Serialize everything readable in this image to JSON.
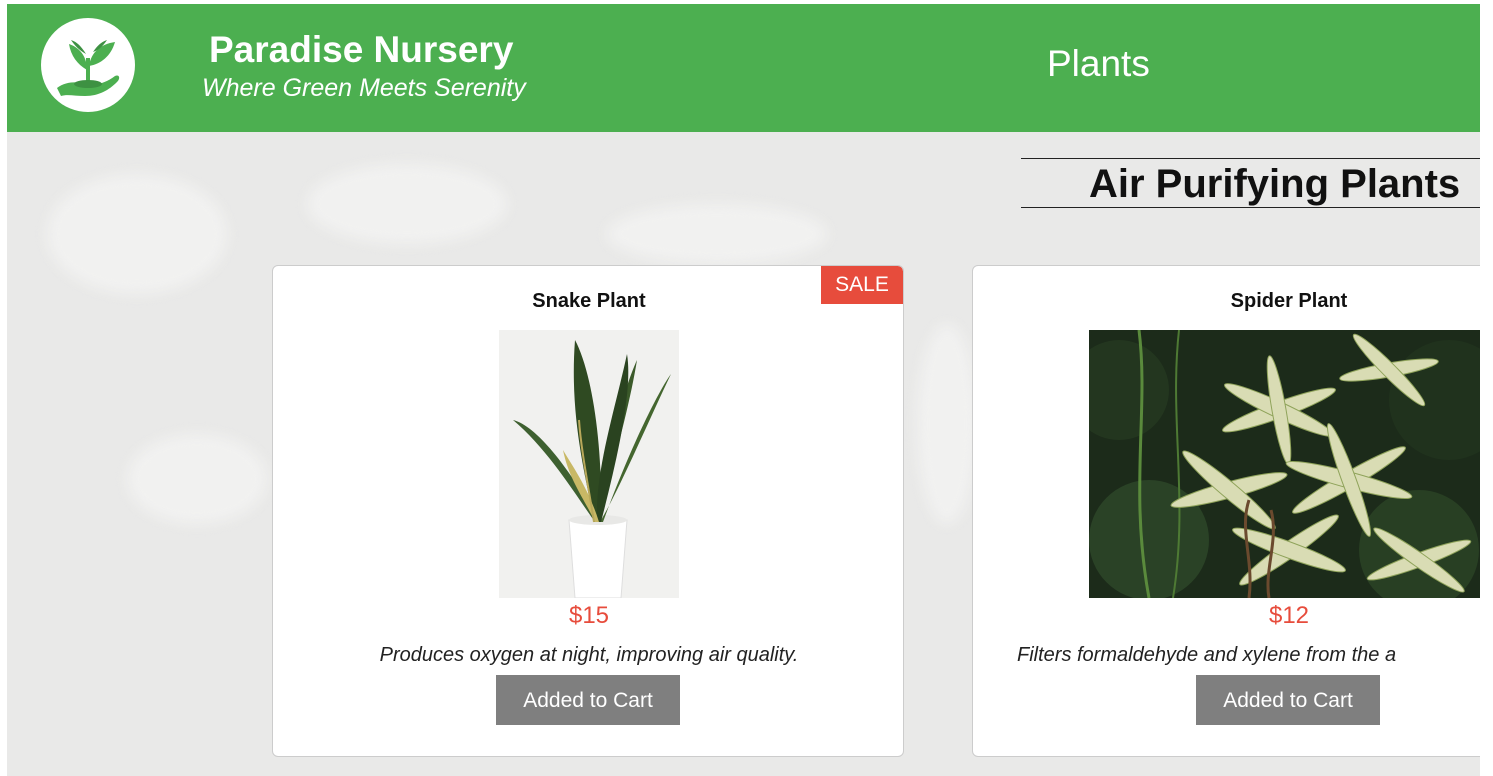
{
  "header": {
    "brand_title": "Paradise Nursery",
    "brand_tagline": "Where Green Meets Serenity",
    "nav_plants": "Plants",
    "logo_icon": "seedling-in-hand-icon",
    "bg_color": "#4caf50"
  },
  "category": {
    "title": "Air Purifying Plants"
  },
  "products": [
    {
      "name": "Snake Plant",
      "badge": "SALE",
      "price": "$15",
      "description": "Produces oxygen at night, improving air quality.",
      "button_label": "Added to Cart"
    },
    {
      "name": "Spider Plant",
      "price": "$12",
      "description": "Filters formaldehyde and xylene from the a",
      "button_label": "Added to Cart"
    }
  ],
  "colors": {
    "accent_green": "#4caf50",
    "sale_red": "#e74c3c",
    "price_red": "#e74c3c",
    "button_gray": "#7f7f7f"
  }
}
